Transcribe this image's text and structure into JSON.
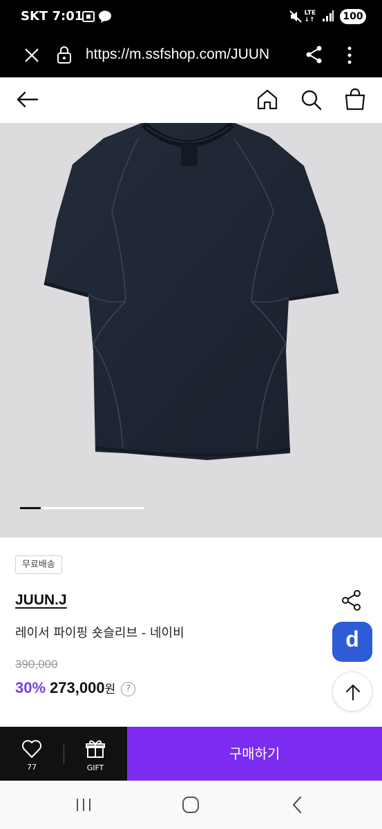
{
  "status_bar": {
    "carrier": "SKT",
    "time": "7:01",
    "network": "LTE",
    "battery": "100"
  },
  "browser": {
    "url": "https://m.ssfshop.com/JUUN"
  },
  "product": {
    "image_index": 1,
    "image_count": 6,
    "badge": "무료배송",
    "brand": "JUUN.J",
    "name": "레이서 파이핑 숏슬리브 - 네이비",
    "original_price": "390,000",
    "discount": "30%",
    "price": "273,000",
    "currency": "원",
    "help_glyph": "?"
  },
  "floating": {
    "d_label": "d"
  },
  "action_bar": {
    "like_count": "77",
    "gift_label": "GIFT",
    "buy_label": "구매하기"
  },
  "colors": {
    "accent_purple": "#7b2cf0",
    "discount_purple": "#7a3ce8",
    "d_button_blue": "#2e5bd6",
    "shirt_navy": "#1e2533"
  },
  "icons": [
    "close-icon",
    "lock-icon",
    "share-icon",
    "more-icon",
    "back-arrow-icon",
    "home-icon",
    "search-icon",
    "bag-icon",
    "heart-icon",
    "gift-icon",
    "arrow-up-icon",
    "recent-apps-icon",
    "home-nav-icon",
    "back-nav-icon"
  ]
}
